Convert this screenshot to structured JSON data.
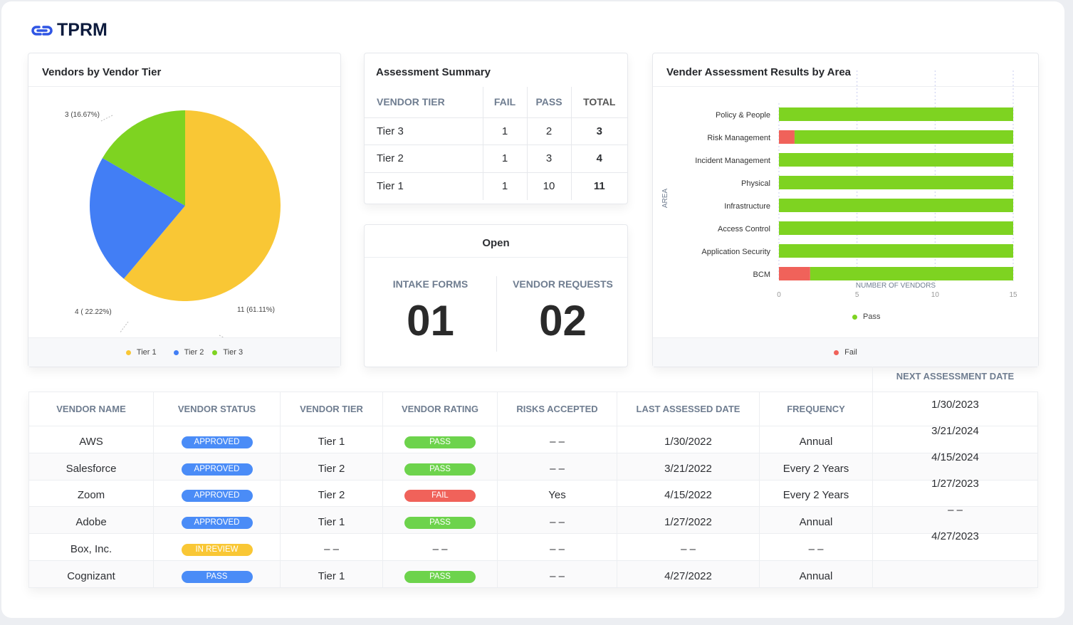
{
  "app": {
    "title": "TPRM",
    "logo_icon": "link-icon"
  },
  "colors": {
    "tier1": "#f9c735",
    "tier2": "#427ef5",
    "tier3": "#7ed321",
    "pass": "#7ed321",
    "fail": "#f0625a",
    "approved": "#4a8cf7",
    "in_review": "#f9c735"
  },
  "pie_card": {
    "title": "Vendors by Vendor Tier",
    "labels": {
      "tier3": "3 (16.67%)",
      "tier2": "4 ( 22.22%)",
      "tier1": "11 (61.11%)"
    },
    "legend": [
      "Tier 1",
      "Tier 2",
      "Tier 3"
    ]
  },
  "chart_data": [
    {
      "type": "pie",
      "title": "Vendors by Vendor Tier",
      "categories": [
        "Tier 1",
        "Tier 2",
        "Tier 3"
      ],
      "values": [
        11,
        4,
        3
      ],
      "percent": [
        61.11,
        22.22,
        16.67
      ],
      "legend_placement": "bottom"
    },
    {
      "type": "bar",
      "orientation": "horizontal",
      "stacked": true,
      "title": "Vender Assessment Results by Area",
      "ylabel": "AREA",
      "xlabel": "NUMBER OF VENDORS",
      "xlim": [
        0,
        15
      ],
      "xticks": [
        0,
        5,
        10,
        15
      ],
      "grid": true,
      "categories": [
        "Policy & People",
        "Risk Management",
        "Incident Management",
        "Physical",
        "Infrastructure",
        "Access Control",
        "Application Security",
        "BCM"
      ],
      "series": [
        {
          "name": "Fail",
          "values": [
            0,
            1,
            0,
            0,
            0,
            0,
            0,
            2
          ]
        },
        {
          "name": "Pass",
          "values": [
            15,
            14,
            15,
            15,
            15,
            15,
            15,
            13
          ]
        }
      ]
    }
  ],
  "summary": {
    "title": "Assessment Summary",
    "headers": [
      "VENDOR TIER",
      "FAIL",
      "PASS",
      "TOTAL"
    ],
    "rows": [
      [
        "Tier 3",
        "1",
        "2",
        "3"
      ],
      [
        "Tier 2",
        "1",
        "3",
        "4"
      ],
      [
        "Tier 1",
        "1",
        "10",
        "11"
      ]
    ]
  },
  "open": {
    "title": "Open",
    "intake_label": "INTAKE FORMS",
    "intake_value": "01",
    "requests_label": "VENDOR REQUESTS",
    "requests_value": "02"
  },
  "vendors": {
    "headers": [
      "VENDOR NAME",
      "VENDOR STATUS",
      "VENDOR TIER",
      "VENDOR RATING",
      "RISKS ACCEPTED",
      "LAST ASSESSED DATE",
      "FREQUENCY"
    ],
    "next_header": "NEXT ASSESSMENT DATE",
    "rows": [
      {
        "name": "AWS",
        "status": "APPROVED",
        "tier": "Tier 1",
        "rating": "PASS",
        "risks": "– –",
        "last": "1/30/2022",
        "freq": "Annual"
      },
      {
        "name": "Salesforce",
        "status": "APPROVED",
        "tier": "Tier 2",
        "rating": "PASS",
        "risks": "– –",
        "last": "3/21/2022",
        "freq": "Every 2 Years"
      },
      {
        "name": "Zoom",
        "status": "APPROVED",
        "tier": "Tier 2",
        "rating": "FAIL",
        "risks": "Yes",
        "last": "4/15/2022",
        "freq": "Every 2 Years"
      },
      {
        "name": "Adobe",
        "status": "APPROVED",
        "tier": "Tier 1",
        "rating": "PASS",
        "risks": "– –",
        "last": "1/27/2022",
        "freq": "Annual"
      },
      {
        "name": "Box, Inc.",
        "status": "IN REVIEW",
        "tier": "– –",
        "rating": "– –",
        "risks": "– –",
        "last": "– –",
        "freq": "– –"
      },
      {
        "name": "Cognizant",
        "status": "PASS",
        "tier": "Tier 1",
        "rating": "PASS",
        "risks": "– –",
        "last": "4/27/2022",
        "freq": "Annual"
      }
    ],
    "next_dates": [
      "1/30/2023",
      "3/21/2024",
      "4/15/2024",
      "1/27/2023",
      "– –",
      "4/27/2023"
    ]
  }
}
